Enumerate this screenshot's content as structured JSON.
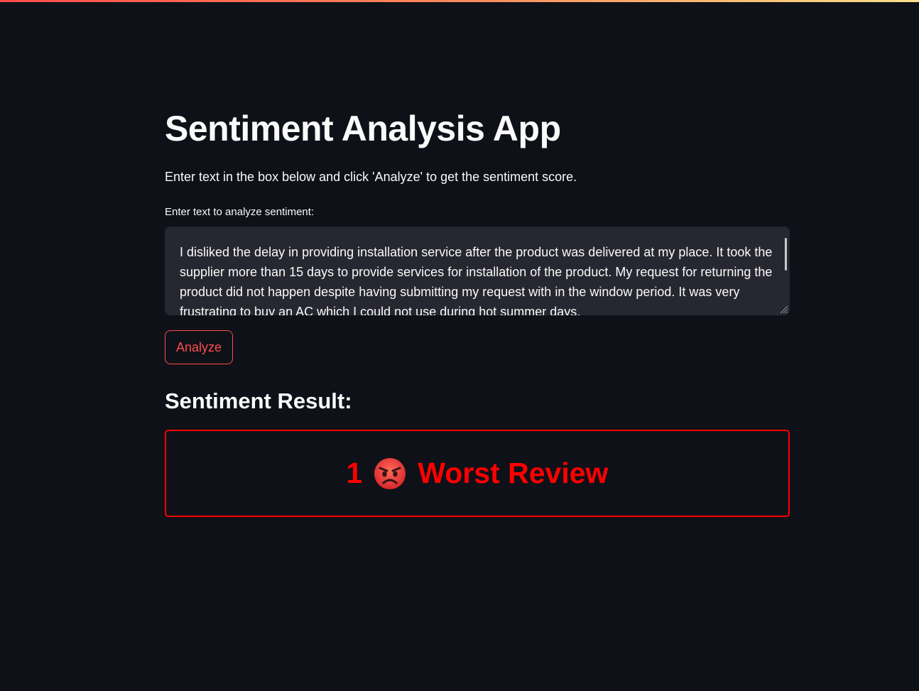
{
  "app": {
    "title": "Sentiment Analysis App",
    "intro": "Enter text in the box below and click 'Analyze' to get the sentiment score."
  },
  "input": {
    "label": "Enter text to analyze sentiment:",
    "value": "I disliked the delay in providing installation service after the product was delivered at my place. It took the supplier more than 15 days to provide services for installation of the product. My request for returning the product did not happen despite having submitting my request with in the window period. It was very frustrating to buy an AC which I could not use during hot summer days."
  },
  "actions": {
    "analyze_label": "Analyze"
  },
  "result": {
    "heading": "Sentiment Result:",
    "score": "1",
    "emoji_icon": "angry-face-icon",
    "label": "Worst Review",
    "color": "#ff0000"
  },
  "theme": {
    "background": "#0e1117",
    "accent": "#ff4b4b",
    "input_background": "#262730"
  }
}
